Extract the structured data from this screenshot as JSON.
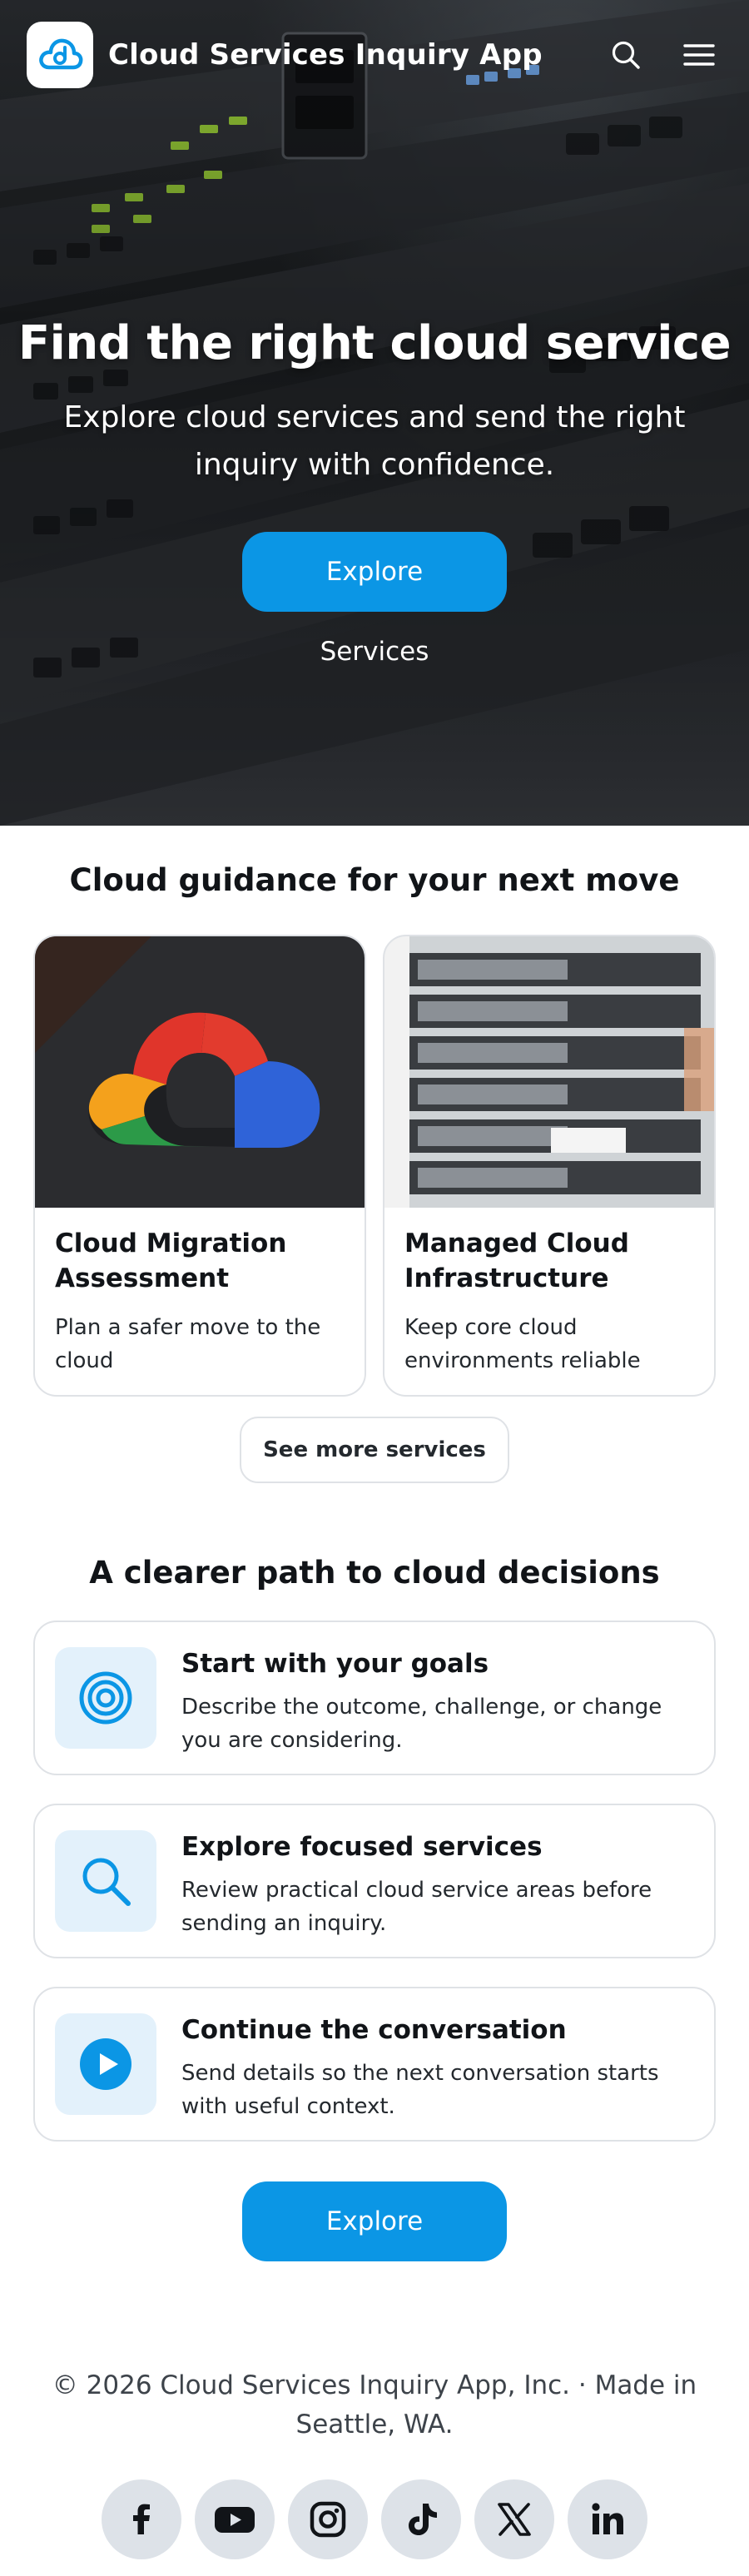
{
  "header": {
    "brand": "Cloud Services Inquiry App",
    "search_icon": "search-icon",
    "menu_icon": "hamburger-menu-icon"
  },
  "hero": {
    "title": "Find the right cloud service",
    "subtitle": "Explore cloud services and send the right inquiry with confidence.",
    "cta_label": "Explore Services"
  },
  "services": {
    "title": "Cloud guidance for your next move",
    "cards": [
      {
        "title": "Cloud Migration Assessment",
        "description": "Plan a safer move to the cloud"
      },
      {
        "title": "Managed Cloud Infrastructure",
        "description": "Keep core cloud environments reliable"
      }
    ],
    "see_more_label": "See more services"
  },
  "path": {
    "title": "A clearer path to cloud decisions",
    "steps": [
      {
        "title": "Start with your goals",
        "description": "Describe the outcome, challenge, or change you are considering.",
        "icon": "target-icon"
      },
      {
        "title": "Explore focused services",
        "description": "Review practical cloud service areas before sending an inquiry.",
        "icon": "search-icon"
      },
      {
        "title": "Continue the conversation",
        "description": "Send details so the next conversation starts with useful context.",
        "icon": "play-circle-icon"
      }
    ],
    "cta_label": "Explore Services"
  },
  "footer": {
    "copyright": "© 2026 Cloud Services Inquiry App, Inc. · Made in Seattle, WA.",
    "socials": [
      "facebook-icon",
      "youtube-icon",
      "instagram-icon",
      "tiktok-icon",
      "x-icon",
      "linkedin-icon"
    ]
  },
  "colors": {
    "accent": "#0b96e5",
    "icon_tile": "#e3f1fb",
    "border": "#dfe2e6",
    "social_bg": "#dde2e8"
  }
}
